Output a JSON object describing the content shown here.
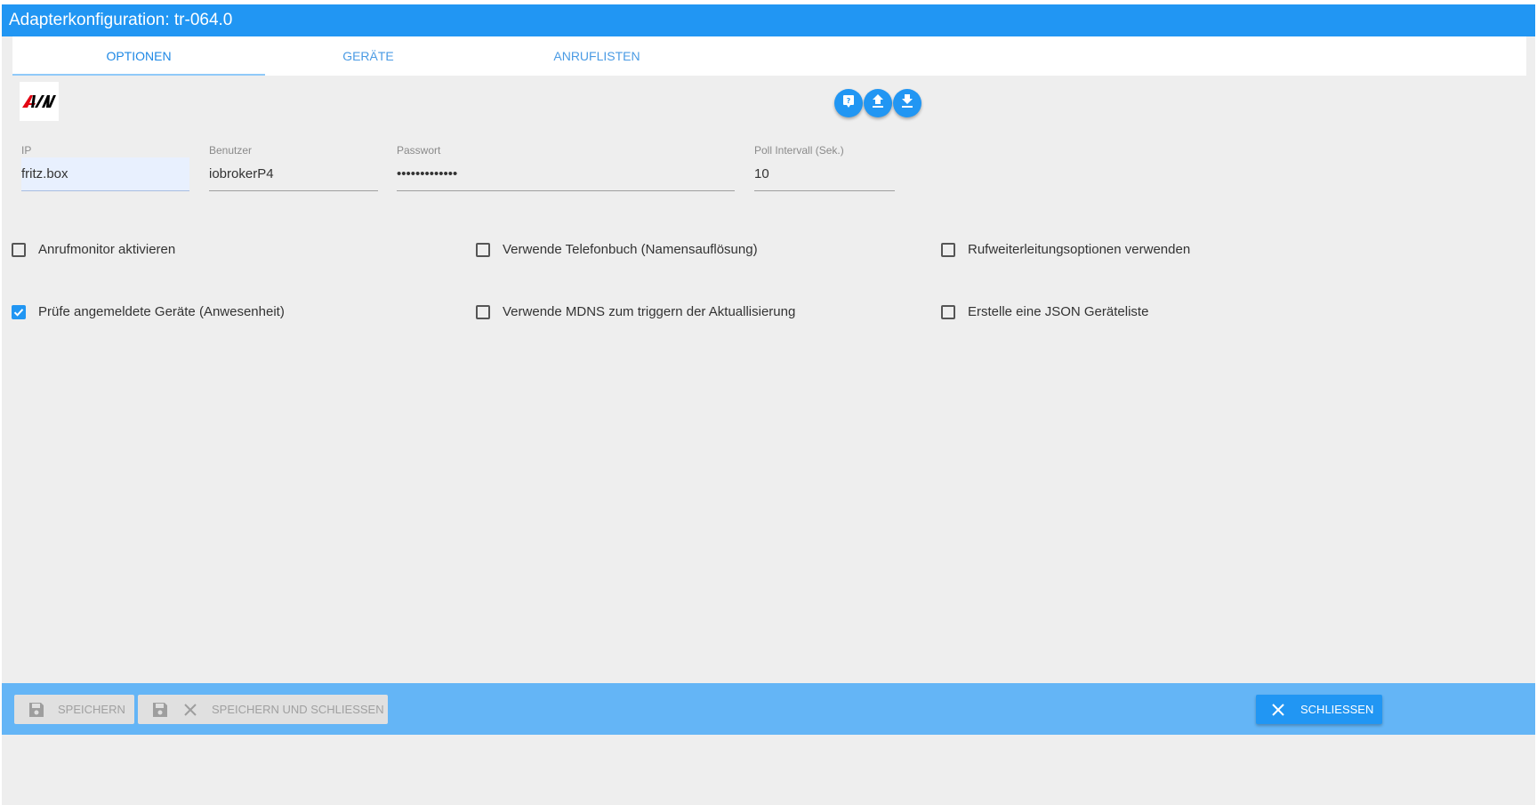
{
  "window": {
    "title": "Adapterkonfiguration: tr-064.0"
  },
  "tabs": [
    {
      "label": "OPTIONEN",
      "active": true
    },
    {
      "label": "GERÄTE",
      "active": false
    },
    {
      "label": "ANRUFLISTEN",
      "active": false
    }
  ],
  "logo": {
    "alt": "AVM"
  },
  "toolbar_icons": [
    "help-icon",
    "upload-icon",
    "download-icon"
  ],
  "fields": {
    "ip": {
      "label": "IP",
      "value": "fritz.box"
    },
    "user": {
      "label": "Benutzer",
      "value": "iobrokerP4"
    },
    "password": {
      "label": "Passwort",
      "value": "•••••••••••••"
    },
    "poll": {
      "label": "Poll Intervall (Sek.)",
      "value": "10"
    }
  },
  "options": [
    {
      "label": "Anrufmonitor aktivieren",
      "checked": false
    },
    {
      "label": "Verwende Telefonbuch (Namensauflösung)",
      "checked": false
    },
    {
      "label": "Rufweiterleitungsoptionen verwenden",
      "checked": false
    },
    {
      "label": "Prüfe angemeldete Geräte (Anwesenheit)",
      "checked": true
    },
    {
      "label": "Verwende MDNS zum triggern der Aktuallisierung",
      "checked": false
    },
    {
      "label": "Erstelle eine JSON Geräteliste",
      "checked": false
    }
  ],
  "footer": {
    "save_label": "SPEICHERN",
    "save_close_label": "SPEICHERN UND SCHLIESSEN",
    "close_label": "SCHLIESSEN"
  },
  "colors": {
    "accent": "#2196f3",
    "footer": "#64b5f6",
    "background": "#eeeeee"
  }
}
